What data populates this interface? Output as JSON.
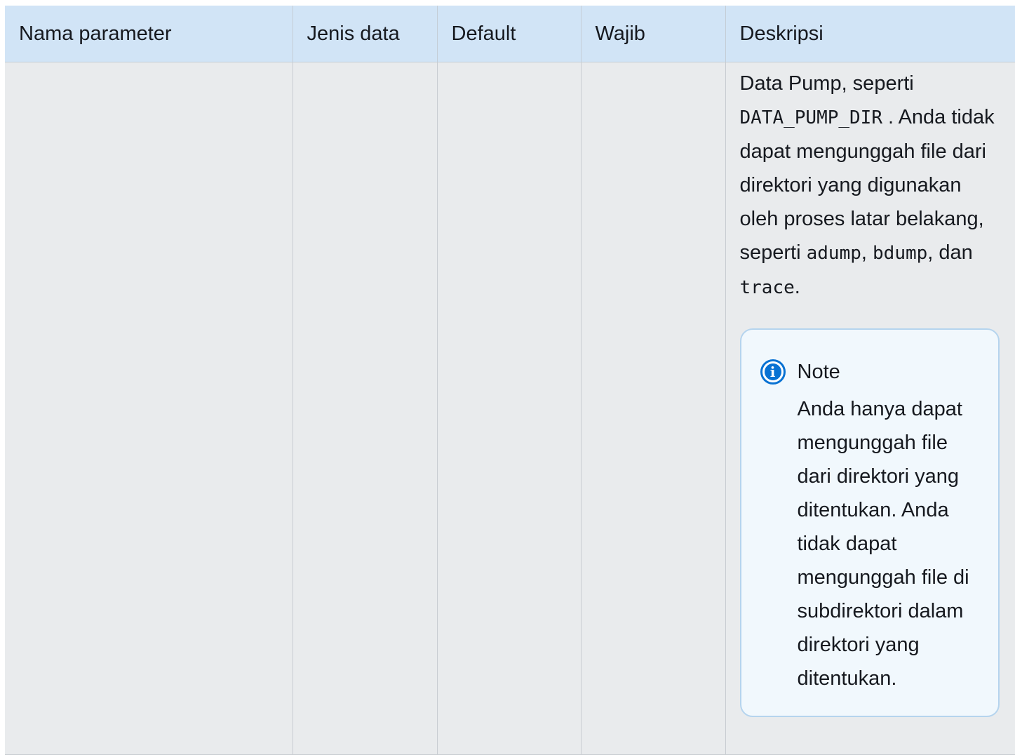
{
  "table": {
    "headers": [
      "Nama parameter",
      "Jenis data",
      "Default",
      "Wajib",
      "Deskripsi"
    ],
    "row": {
      "desc_part1": "Data Pump, seperti ",
      "desc_code1": "DATA_PUMP_DIR",
      "desc_part2": " . Anda tidak dapat mengunggah file dari direktori yang digunakan oleh proses latar belakang, seperti ",
      "desc_code2": "adump",
      "desc_sep1": ", ",
      "desc_code3": "bdump",
      "desc_sep2": ", dan ",
      "desc_code4": "trace",
      "desc_end": "."
    }
  },
  "note": {
    "title": "Note",
    "icon": "info-icon",
    "body": "Anda hanya dapat mengunggah file dari direktori yang ditentukan. Anda tidak dapat mengunggah file di subdirektori dalam direktori yang ditentukan."
  },
  "colors": {
    "header_bg": "#d1e4f6",
    "cell_bg": "#e9ebed",
    "note_bg": "#f1f8fd",
    "note_border": "#b5d4ee",
    "info_blue": "#0972d3"
  }
}
